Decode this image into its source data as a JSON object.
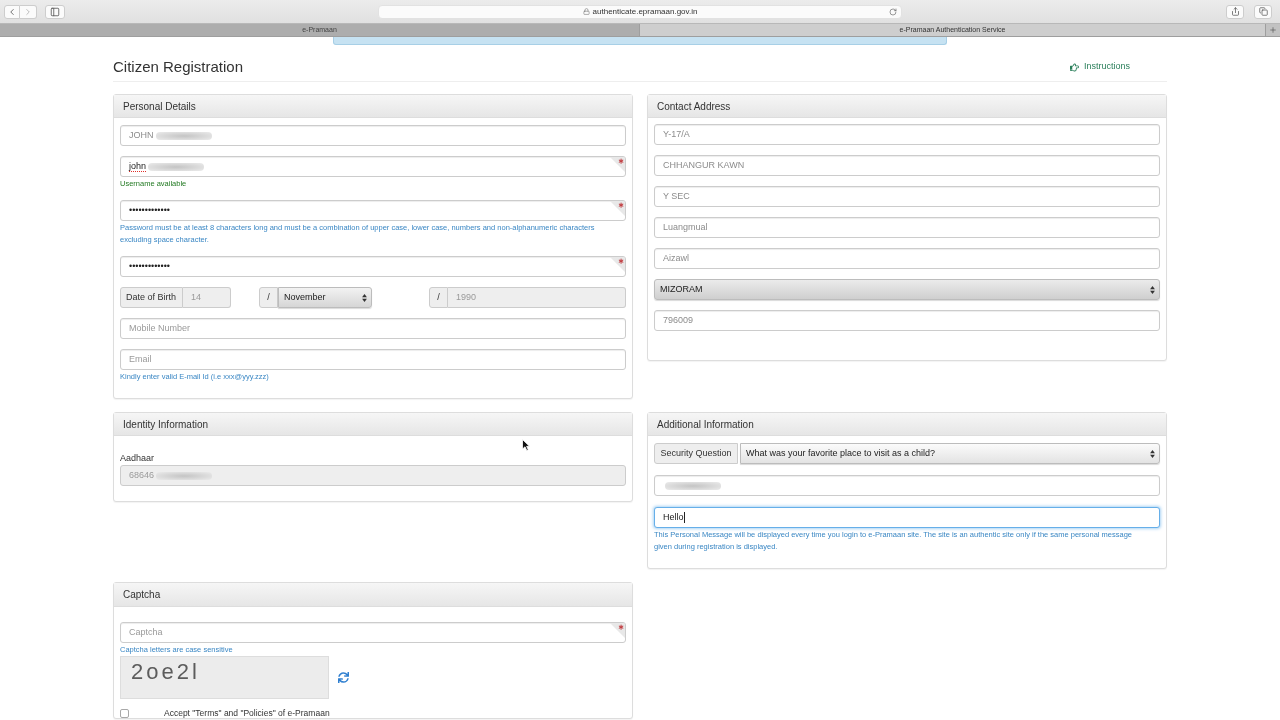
{
  "browser": {
    "url": "authenticate.epramaan.gov.in",
    "tabs": [
      {
        "title": "e-Pramaan",
        "selected": false
      },
      {
        "title": "e-Pramaan Authentication Service",
        "selected": true
      }
    ]
  },
  "page": {
    "title": "Citizen Registration",
    "instructions_link": "Instructions"
  },
  "personal_details": {
    "title": "Personal Details",
    "fields": [
      {
        "kind": "input",
        "value": "JOHN",
        "readonly": true,
        "disabled": false,
        "focused": false,
        "required": false,
        "redacted": true,
        "misspelled": false
      },
      {
        "kind": "input",
        "value": "john",
        "readonly": false,
        "disabled": false,
        "focused": false,
        "required": true,
        "redacted": true,
        "misspelled": true,
        "help": {
          "kind": "success",
          "text": "Username available"
        }
      },
      {
        "kind": "input",
        "value": "•••••••••••••",
        "readonly": false,
        "disabled": false,
        "focused": false,
        "required": true,
        "redacted": false,
        "misspelled": false,
        "help": {
          "kind": "hint",
          "text": "Password must be at least 8 characters long and must be a combination of upper case, lower case, numbers and non-alphanumeric characters excluding space character."
        }
      },
      {
        "kind": "input",
        "value": "•••••••••••••",
        "readonly": false,
        "disabled": false,
        "focused": false,
        "required": true,
        "redacted": false,
        "misspelled": false
      },
      {
        "kind": "date",
        "label": "Date of Birth",
        "day": {
          "value": "14",
          "disabled": true
        },
        "month": {
          "value": "November"
        },
        "year": {
          "value": "1990",
          "disabled": true
        },
        "separators": [
          "/",
          "/"
        ]
      },
      {
        "kind": "input",
        "placeholder": "Mobile Number",
        "readonly": false,
        "disabled": false,
        "focused": false,
        "required": false,
        "redacted": false,
        "misspelled": false
      },
      {
        "kind": "input",
        "placeholder": "Email",
        "readonly": false,
        "disabled": false,
        "focused": false,
        "required": false,
        "redacted": false,
        "misspelled": false,
        "help": {
          "kind": "hint",
          "text": "Kindly enter valid E-mail Id (i.e xxx@yyy.zzz)"
        }
      }
    ]
  },
  "contact_address": {
    "title": "Contact Address",
    "fields": [
      {
        "kind": "input",
        "value": "Y-17/A",
        "readonly": true,
        "disabled": false,
        "focused": false,
        "required": false,
        "redacted": false,
        "misspelled": false
      },
      {
        "kind": "input",
        "value": "CHHANGUR KAWN",
        "readonly": true,
        "disabled": false,
        "focused": false,
        "required": false,
        "redacted": false,
        "misspelled": false
      },
      {
        "kind": "input",
        "value": "Y SEC",
        "readonly": true,
        "disabled": false,
        "focused": false,
        "required": false,
        "redacted": false,
        "misspelled": false
      },
      {
        "kind": "input",
        "value": "Luangmual",
        "readonly": true,
        "disabled": false,
        "focused": false,
        "required": false,
        "redacted": false,
        "misspelled": false
      },
      {
        "kind": "input",
        "value": "Aizawl",
        "readonly": true,
        "disabled": false,
        "focused": false,
        "required": false,
        "redacted": false,
        "misspelled": false
      },
      {
        "kind": "select",
        "value": "MIZORAM"
      },
      {
        "kind": "input",
        "value": "796009",
        "readonly": true,
        "disabled": false,
        "focused": false,
        "required": false,
        "redacted": false,
        "misspelled": false
      }
    ]
  },
  "identity_information": {
    "title": "Identity Information",
    "fields": [
      {
        "kind": "input",
        "label": "Aadhaar",
        "value": "68646",
        "disabled": true,
        "focused": false,
        "required": false,
        "redacted": true,
        "misspelled": false
      }
    ]
  },
  "additional_information": {
    "title": "Additional Information",
    "fields": [
      {
        "kind": "labeled_select",
        "label": "Security Question",
        "value": "What was your favorite place to visit as a child?"
      },
      {
        "kind": "input",
        "disabled": false,
        "focused": false,
        "required": false,
        "redacted": true
      },
      {
        "kind": "input",
        "value": "Hello",
        "readonly": false,
        "disabled": false,
        "focused": true,
        "required": false,
        "redacted": false,
        "misspelled": false,
        "help": {
          "kind": "hint",
          "text": "This Personal Message will be displayed every time you login to e-Pramaan site. The site is an authentic site only if the same personal message given during registration is displayed."
        }
      }
    ]
  },
  "captcha": {
    "title": "Captcha",
    "fields": [
      {
        "kind": "input",
        "placeholder": "Captcha",
        "readonly": false,
        "disabled": false,
        "focused": false,
        "required": true,
        "redacted": false,
        "misspelled": false,
        "help": {
          "kind": "hint",
          "text": "Captcha letters are case sensitive"
        }
      },
      {
        "kind": "captcha_image",
        "text": "2oe2l"
      },
      {
        "kind": "checkbox",
        "label": "Accept \"Terms\" and \"Policies\" of e-Pramaan",
        "checked": false
      }
    ]
  }
}
